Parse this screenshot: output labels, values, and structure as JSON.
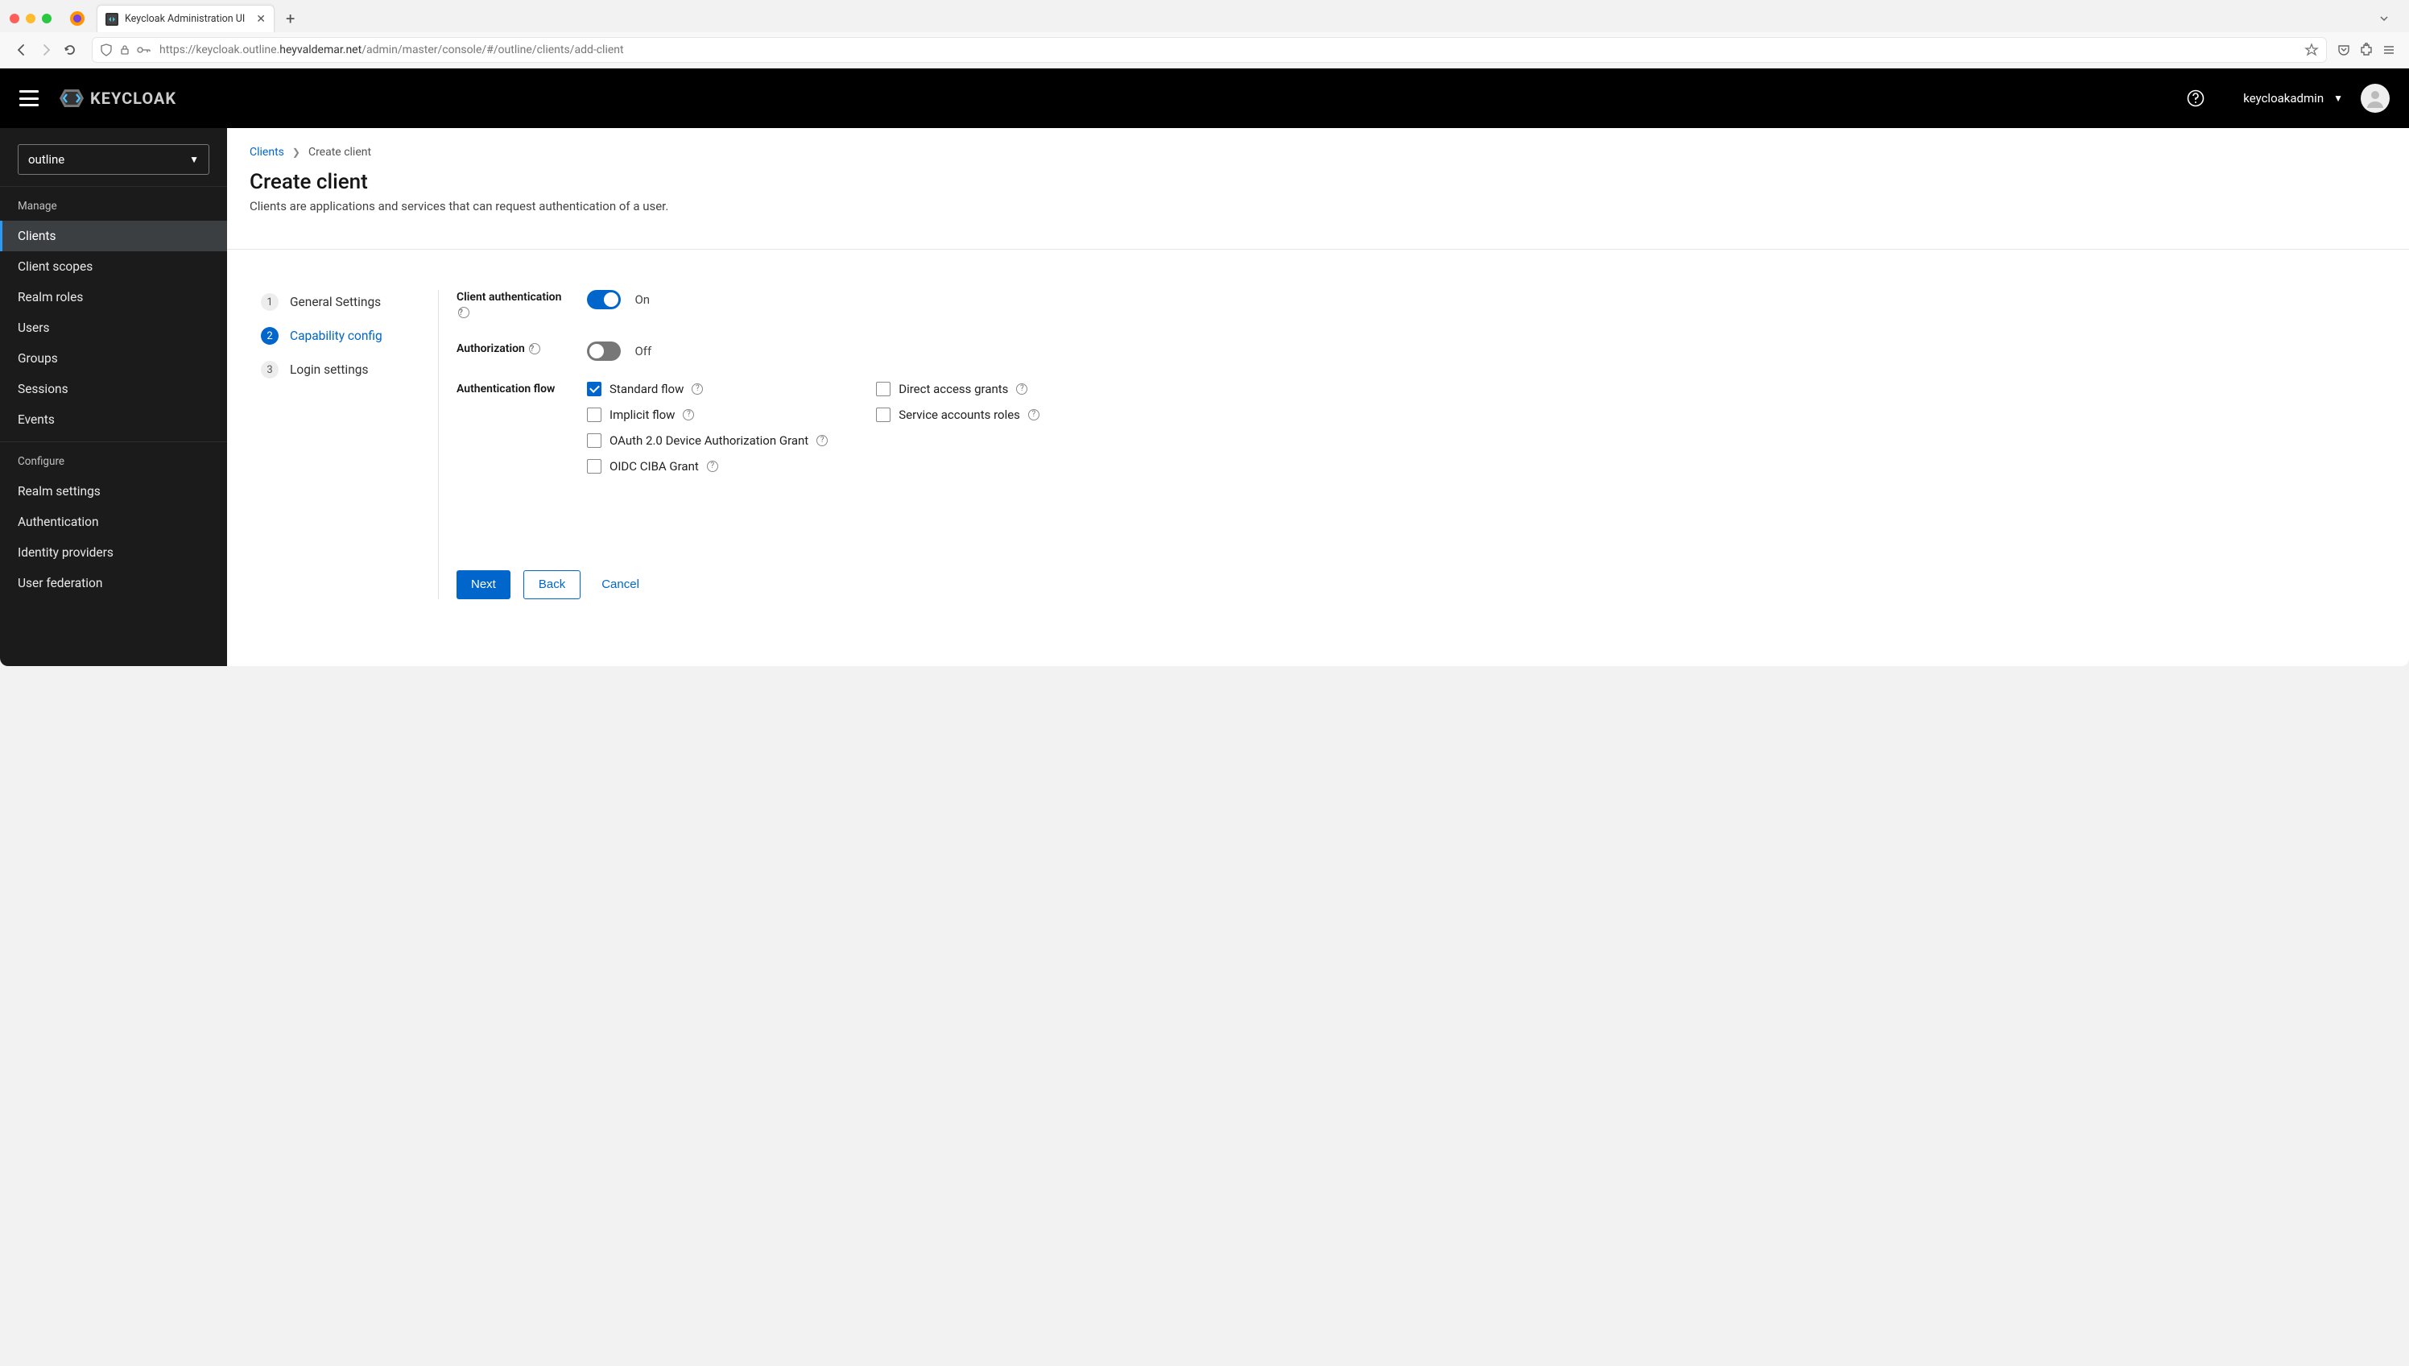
{
  "browser": {
    "tab_title": "Keycloak Administration UI",
    "url_prefix": "https://keycloak.outline.",
    "url_bold": "heyvaldemar.net",
    "url_suffix": "/admin/master/console/#/outline/clients/add-client"
  },
  "header": {
    "brand": "KEYCLOAK",
    "user": "keycloakadmin"
  },
  "sidebar": {
    "realm": "outline",
    "manage_title": "Manage",
    "configure_title": "Configure",
    "manage_items": [
      "Clients",
      "Client scopes",
      "Realm roles",
      "Users",
      "Groups",
      "Sessions",
      "Events"
    ],
    "configure_items": [
      "Realm settings",
      "Authentication",
      "Identity providers",
      "User federation"
    ],
    "active_index": 0
  },
  "breadcrumb": {
    "link": "Clients",
    "current": "Create client"
  },
  "page": {
    "title": "Create client",
    "description": "Clients are applications and services that can request authentication of a user."
  },
  "steps": [
    {
      "num": "1",
      "label": "General Settings"
    },
    {
      "num": "2",
      "label": "Capability config"
    },
    {
      "num": "3",
      "label": "Login settings"
    }
  ],
  "active_step": 1,
  "form": {
    "client_auth_label": "Client authentication",
    "client_auth_on": true,
    "on_text": "On",
    "authorization_label": "Authorization",
    "authorization_on": false,
    "off_text": "Off",
    "auth_flow_label": "Authentication flow",
    "flows_left": [
      {
        "label": "Standard flow",
        "checked": true,
        "help": true
      },
      {
        "label": "Implicit flow",
        "checked": false,
        "help": true
      },
      {
        "label": "OAuth 2.0 Device Authorization Grant",
        "checked": false,
        "help": true
      },
      {
        "label": "OIDC CIBA Grant",
        "checked": false,
        "help": true
      }
    ],
    "flows_right": [
      {
        "label": "Direct access grants",
        "checked": false,
        "help": true
      },
      {
        "label": "Service accounts roles",
        "checked": false,
        "help": true
      }
    ]
  },
  "actions": {
    "next": "Next",
    "back": "Back",
    "cancel": "Cancel"
  }
}
